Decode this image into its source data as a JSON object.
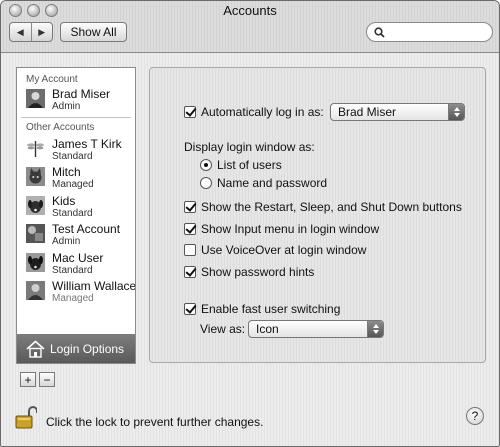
{
  "window": {
    "title": "Accounts"
  },
  "toolbar": {
    "show_all": "Show All",
    "search_placeholder": ""
  },
  "accounts": {
    "my_account_header": "My Account",
    "other_accounts_header": "Other Accounts",
    "my": {
      "name": "Brad Miser",
      "role": "Admin",
      "icon": "user-photo-icon"
    },
    "others": [
      {
        "name": "James T Kirk",
        "role": "Standard",
        "icon": "dragonfly-icon"
      },
      {
        "name": "Mitch",
        "role": "Managed",
        "icon": "cat-icon"
      },
      {
        "name": "Kids",
        "role": "Standard",
        "icon": "dog-icon"
      },
      {
        "name": "Test Account",
        "role": "Admin",
        "icon": "abstract-icon"
      },
      {
        "name": "Mac User",
        "role": "Standard",
        "icon": "dog-icon"
      },
      {
        "name": "William Wallace",
        "role": "Managed",
        "icon": "user-photo-icon"
      }
    ],
    "login_options": "Login Options",
    "add": "+",
    "remove": "−"
  },
  "options": {
    "auto_login_label": "Automatically log in as:",
    "auto_login_checked": true,
    "auto_login_user": "Brad Miser",
    "display_as_label": "Display login window as:",
    "radio_list": "List of users",
    "radio_name": "Name and password",
    "radio_selected": "list",
    "show_restart": {
      "label": "Show the Restart, Sleep, and Shut Down buttons",
      "checked": true
    },
    "show_input_menu": {
      "label": "Show Input menu in login window",
      "checked": true
    },
    "use_voiceover": {
      "label": "Use VoiceOver at login window",
      "checked": false
    },
    "show_hints": {
      "label": "Show password hints",
      "checked": true
    },
    "fast_switching": {
      "label": "Enable fast user switching",
      "checked": true
    },
    "view_as_label": "View as:",
    "view_as_value": "Icon"
  },
  "footer": {
    "lock_text": "Click the lock to prevent further changes.",
    "help": "?"
  }
}
